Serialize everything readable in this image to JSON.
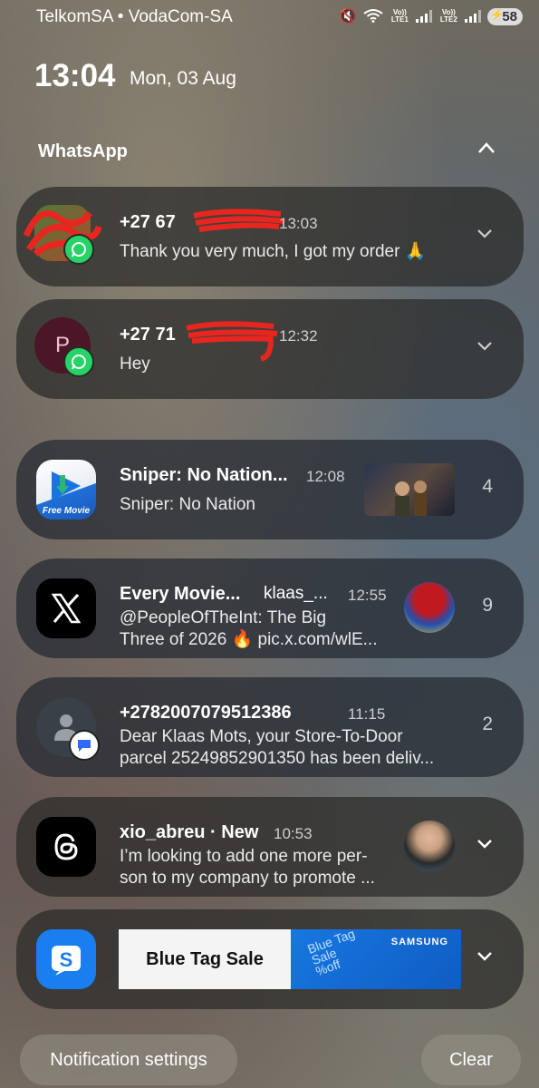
{
  "status_bar": {
    "carrier": "TelkomSA • VodaCom-SA",
    "lte1": "Vo)) LTE1",
    "lte2": "Vo)) LTE2",
    "battery": "58"
  },
  "lockscreen": {
    "time": "13:04",
    "date": "Mon, 03 Aug"
  },
  "whatsapp_group": {
    "title": "WhatsApp"
  },
  "notifications": [
    {
      "title": "+27 67",
      "time": "13:03",
      "body": "Thank you very much, I got my order 🙏"
    },
    {
      "title": "+27 71",
      "time": "12:32",
      "body": "Hey",
      "avatar_letter": "P"
    },
    {
      "title": "Sniper: No Nation...",
      "time": "12:08",
      "body": "Sniper: No Nation",
      "count": "4",
      "icon_label": "Free Movie"
    },
    {
      "title": "Every Movie...",
      "subtitle": "klaas_...",
      "time": "12:55",
      "body1": "@PeopleOfTheInt: The Big",
      "body2": "Three of 2026 🔥 pic.x.com/wlE...",
      "count": "9"
    },
    {
      "title": "+2782007079512386",
      "time": "11:15",
      "body1": "Dear Klaas Mots, your Store-To-Door",
      "body2": "parcel 25249852901350 has been deliv...",
      "count": "2"
    },
    {
      "title": "xio_abreu · New",
      "time": "10:53",
      "body1": "I’m looking to add one more per-",
      "body2": "son to my company to promote ..."
    },
    {
      "banner_text": "Blue Tag Sale",
      "brand": "SAMSUNG",
      "promo": "Blue Tag Sale %off"
    }
  ],
  "footer": {
    "settings": "Notification settings",
    "clear": "Clear"
  },
  "colors": {
    "whatsapp": "#25d366",
    "messages_blue": "#2f6cf5",
    "samsung_blue": "#1a7ef0"
  }
}
